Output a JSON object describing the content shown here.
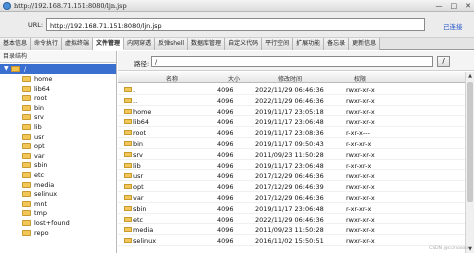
{
  "window": {
    "title": "http://192.168.71.151:8080/ljn.jsp"
  },
  "address_bar": {
    "label": "URL:",
    "value": "http://192.168.71.151:8080/ljn.jsp",
    "go_label": "己连接"
  },
  "tabs": [
    {
      "label": "基本信息"
    },
    {
      "label": "命令执行"
    },
    {
      "label": "虚拟终端"
    },
    {
      "label": "文件管理"
    },
    {
      "label": "内网穿透"
    },
    {
      "label": "反弹shell"
    },
    {
      "label": "数据库管理"
    },
    {
      "label": "自定义代码"
    },
    {
      "label": "平行空间"
    },
    {
      "label": "扩展功能"
    },
    {
      "label": "备忘录"
    },
    {
      "label": "更新信息"
    }
  ],
  "active_tab": "文件管理",
  "sidebar": {
    "header": "目录结构",
    "root": "/",
    "items": [
      {
        "label": "home"
      },
      {
        "label": "lib64"
      },
      {
        "label": "root"
      },
      {
        "label": "bin"
      },
      {
        "label": "srv"
      },
      {
        "label": "lib"
      },
      {
        "label": "usr"
      },
      {
        "label": "opt"
      },
      {
        "label": "var"
      },
      {
        "label": "sbin"
      },
      {
        "label": "etc"
      },
      {
        "label": "media"
      },
      {
        "label": "selinux"
      },
      {
        "label": "mnt"
      },
      {
        "label": "tmp"
      },
      {
        "label": "lost+found"
      },
      {
        "label": "repo"
      }
    ]
  },
  "path": {
    "label": "路径:",
    "value": "/",
    "go_button": "/"
  },
  "table": {
    "headers": {
      "name": "名称",
      "size": "大小",
      "time": "修改时间",
      "perm": "权限"
    },
    "rows": [
      {
        "name": ".",
        "size": "4096",
        "time": "2022/11/29 06:46:36",
        "perm": "rwxr-xr-x"
      },
      {
        "name": "..",
        "size": "4096",
        "time": "2022/11/29 06:46:36",
        "perm": "rwxr-xr-x"
      },
      {
        "name": "home",
        "size": "4096",
        "time": "2019/11/17 23:05:18",
        "perm": "rwxr-xr-x"
      },
      {
        "name": "lib64",
        "size": "4096",
        "time": "2019/11/17 23:06:48",
        "perm": "rwxr-xr-x"
      },
      {
        "name": "root",
        "size": "4096",
        "time": "2019/11/17 23:08:36",
        "perm": "r-xr-x---"
      },
      {
        "name": "bin",
        "size": "4096",
        "time": "2019/11/17 09:50:43",
        "perm": "r-xr-xr-x"
      },
      {
        "name": "srv",
        "size": "4096",
        "time": "2011/09/23 11:50:28",
        "perm": "rwxr-xr-x"
      },
      {
        "name": "lib",
        "size": "4096",
        "time": "2019/11/17 23:06:48",
        "perm": "r-xr-xr-x"
      },
      {
        "name": "usr",
        "size": "4096",
        "time": "2017/12/29 06:46:36",
        "perm": "rwxr-xr-x"
      },
      {
        "name": "opt",
        "size": "4096",
        "time": "2017/12/29 06:46:39",
        "perm": "rwxr-xr-x"
      },
      {
        "name": "var",
        "size": "4096",
        "time": "2017/12/29 06:46:36",
        "perm": "rwxr-xr-x"
      },
      {
        "name": "sbin",
        "size": "4096",
        "time": "2019/11/17 23:06:48",
        "perm": "r-xr-xr-x"
      },
      {
        "name": "etc",
        "size": "4096",
        "time": "2022/11/29 06:46:36",
        "perm": "rwxr-xr-x"
      },
      {
        "name": "media",
        "size": "4096",
        "time": "2011/09/23 11:50:28",
        "perm": "rwxr-xr-x"
      },
      {
        "name": "selinux",
        "size": "4096",
        "time": "2016/11/02 15:50:51",
        "perm": "rwxr-xr-x"
      }
    ]
  },
  "watermark": "CSDN @ccinoooo"
}
